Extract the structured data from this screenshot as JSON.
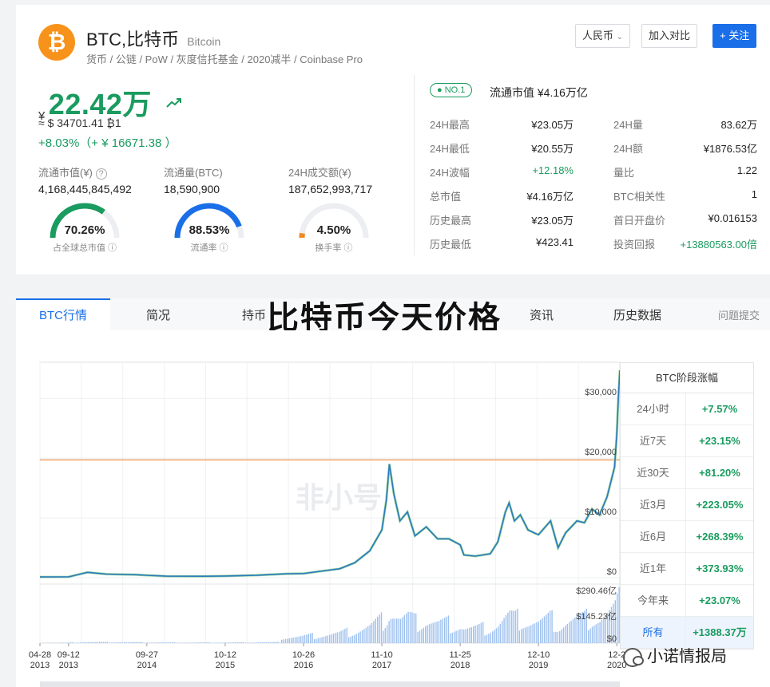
{
  "coin": {
    "logo_glyph": "₿",
    "name": "BTC,比特币",
    "en_name": "Bitcoin",
    "tags": "货币 / 公链 / PoW / 灰度信托基金 / 2020减半 / Coinbase Pro"
  },
  "header": {
    "currency_select": "人民币",
    "compare_button": "加入对比",
    "follow_button": "+ 关注"
  },
  "price": {
    "currency_symbol": "¥",
    "value": "22.42万",
    "trend_icon": "trend-up-icon",
    "usd_line": "≈ $ 34701.41  ₿1",
    "change": "+8.03%（+ ¥ 16671.38 ）"
  },
  "stats": {
    "circ_mcap_label": "流通市值(¥) ",
    "circ_mcap_value": "4,168,445,845,492",
    "circ_supply_label": "流通量(BTC)",
    "circ_supply_value": "18,590,900",
    "vol24_label": "24H成交额(¥)",
    "vol24_value": "187,652,993,717"
  },
  "gauges": [
    {
      "pct": "70.26%",
      "caption": "占全球总市值",
      "fraction": 0.7026,
      "color": "#1a9b5f"
    },
    {
      "pct": "88.53%",
      "caption": "流通率",
      "fraction": 0.8853,
      "color": "#1a6fe8"
    },
    {
      "pct": "4.50%",
      "caption": "换手率",
      "fraction": 0.045,
      "color": "#f08a24"
    }
  ],
  "rank": {
    "badge": "NO.1",
    "mcap_line": "流通市值  ¥4.16万亿"
  },
  "market": {
    "left": [
      {
        "label": "24H最高",
        "value": "¥23.05万",
        "up": false
      },
      {
        "label": "24H最低",
        "value": "¥20.55万",
        "up": false
      },
      {
        "label": "24H波幅",
        "value": "+12.18%",
        "up": true
      },
      {
        "label": "总市值",
        "value": "¥4.16万亿",
        "up": false
      },
      {
        "label": "历史最高",
        "value": "¥23.05万",
        "up": false
      },
      {
        "label": "历史最低",
        "value": "¥423.41",
        "up": false
      }
    ],
    "right": [
      {
        "label": "24H量",
        "value": "83.62万",
        "up": false
      },
      {
        "label": "24H额",
        "value": "¥1876.53亿",
        "up": false
      },
      {
        "label": "量比",
        "value": "1.22",
        "up": false
      },
      {
        "label": "BTC相关性",
        "value": "1",
        "up": false
      },
      {
        "label": "首日开盘价",
        "value": "¥0.016153",
        "up": false
      },
      {
        "label": "投资回报",
        "value": "+13880563.00倍",
        "up": true
      }
    ]
  },
  "tabs": [
    "BTC行情",
    "简况",
    "持币",
    "",
    "",
    "资讯",
    "历史数据",
    "问题提交"
  ],
  "overlay_title": "比特币今天价格",
  "watermark": "非小号",
  "performance": {
    "title": "BTC阶段涨幅",
    "rows": [
      {
        "label": "24小时",
        "value": "+7.57%"
      },
      {
        "label": "近7天",
        "value": "+23.15%"
      },
      {
        "label": "近30天",
        "value": "+81.20%"
      },
      {
        "label": "近3月",
        "value": "+223.05%"
      },
      {
        "label": "近6月",
        "value": "+268.39%"
      },
      {
        "label": "近1年",
        "value": "+373.93%"
      },
      {
        "label": "今年来",
        "value": "+23.07%"
      },
      {
        "label": "所有",
        "value": "+1388.37万"
      }
    ]
  },
  "footer_brand": "小诺情报局",
  "chart_data": {
    "type": "line",
    "title": "",
    "price_ticks": [
      "$30,000",
      "$20,000",
      "$10,000",
      "$0"
    ],
    "price_tick_values": [
      30000,
      20000,
      10000,
      0
    ],
    "volume_ticks": [
      "$290.46亿",
      "$145.23亿",
      "$0"
    ],
    "volume_tick_values": [
      290.46,
      145.23,
      0
    ],
    "x_ticks": [
      {
        "date": "04-28",
        "year": "2013",
        "t": 2013.32
      },
      {
        "date": "09-12",
        "year": "2013",
        "t": 2013.7
      },
      {
        "date": "09-27",
        "year": "2014",
        "t": 2014.74
      },
      {
        "date": "10-12",
        "year": "2015",
        "t": 2015.78
      },
      {
        "date": "10-26",
        "year": "2016",
        "t": 2016.82
      },
      {
        "date": "11-10",
        "year": "2017",
        "t": 2017.86
      },
      {
        "date": "11-25",
        "year": "2018",
        "t": 2018.9
      },
      {
        "date": "12-10",
        "year": "2019",
        "t": 2019.94
      },
      {
        "date": "12-2",
        "year": "2020",
        "t": 2020.98
      }
    ],
    "reference_line": 19700,
    "series": [
      {
        "values": [
          [
            2013.32,
            120
          ],
          [
            2013.7,
            130
          ],
          [
            2013.95,
            900
          ],
          [
            2014.2,
            600
          ],
          [
            2014.6,
            500
          ],
          [
            2014.74,
            400
          ],
          [
            2015.0,
            250
          ],
          [
            2015.5,
            240
          ],
          [
            2015.78,
            280
          ],
          [
            2016.2,
            420
          ],
          [
            2016.6,
            650
          ],
          [
            2016.82,
            700
          ],
          [
            2017.0,
            1000
          ],
          [
            2017.3,
            1500
          ],
          [
            2017.5,
            2500
          ],
          [
            2017.7,
            4500
          ],
          [
            2017.86,
            8000
          ],
          [
            2017.92,
            13000
          ],
          [
            2017.96,
            19000
          ],
          [
            2018.02,
            14000
          ],
          [
            2018.1,
            9500
          ],
          [
            2018.2,
            11000
          ],
          [
            2018.3,
            7000
          ],
          [
            2018.45,
            8500
          ],
          [
            2018.6,
            6500
          ],
          [
            2018.75,
            6500
          ],
          [
            2018.9,
            5500
          ],
          [
            2018.95,
            3800
          ],
          [
            2019.1,
            3600
          ],
          [
            2019.3,
            4000
          ],
          [
            2019.4,
            6000
          ],
          [
            2019.5,
            11000
          ],
          [
            2019.55,
            12500
          ],
          [
            2019.62,
            9500
          ],
          [
            2019.7,
            10500
          ],
          [
            2019.8,
            8000
          ],
          [
            2019.9,
            7400
          ],
          [
            2019.94,
            7200
          ],
          [
            2020.1,
            9500
          ],
          [
            2020.2,
            5000
          ],
          [
            2020.3,
            7500
          ],
          [
            2020.45,
            9500
          ],
          [
            2020.55,
            9200
          ],
          [
            2020.65,
            11500
          ],
          [
            2020.75,
            10500
          ],
          [
            2020.85,
            13500
          ],
          [
            2020.9,
            16000
          ],
          [
            2020.95,
            18500
          ],
          [
            2020.98,
            24000
          ],
          [
            2021.0,
            30000
          ],
          [
            2021.02,
            34700
          ]
        ]
      }
    ]
  }
}
